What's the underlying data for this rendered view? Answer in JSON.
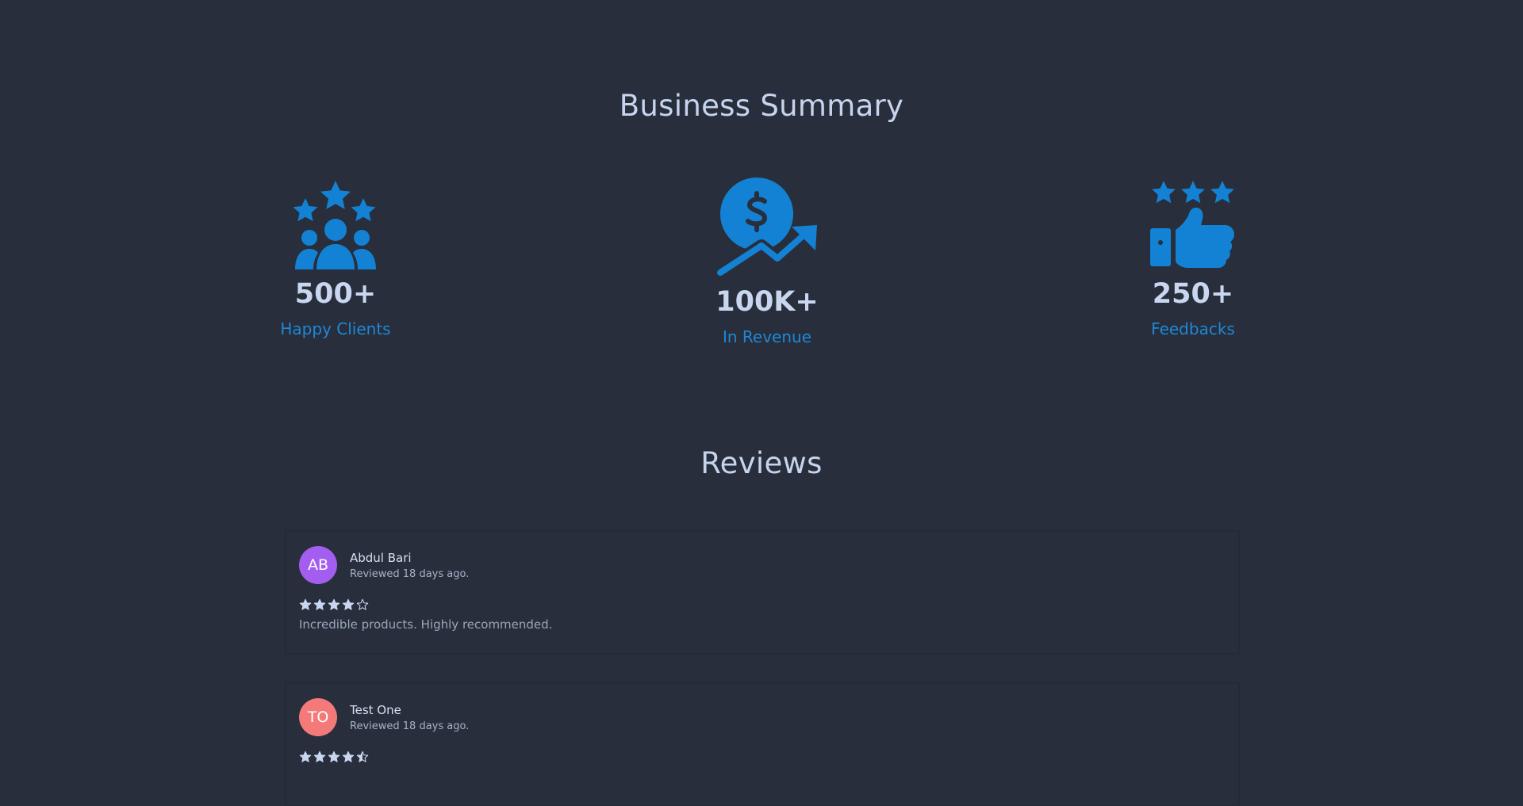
{
  "summary": {
    "title": "Business Summary",
    "stats": [
      {
        "value": "500+",
        "label": "Happy Clients",
        "icon": "clients-stars-icon"
      },
      {
        "value": "100K+",
        "label": "In Revenue",
        "icon": "revenue-growth-icon"
      },
      {
        "value": "250+",
        "label": "Feedbacks",
        "icon": "thumbs-up-stars-icon"
      }
    ]
  },
  "reviews": {
    "title": "Reviews",
    "items": [
      {
        "initials": "AB",
        "avatar_color": "#a35ef0",
        "name": "Abdul Bari",
        "date": "Reviewed 18 days ago.",
        "rating": 4,
        "text": "Incredible products. Highly recommended."
      },
      {
        "initials": "TO",
        "avatar_color": "#f47a7a",
        "name": "Test One",
        "date": "Reviewed 18 days ago.",
        "rating": 4.5,
        "text": ""
      }
    ]
  },
  "colors": {
    "background": "#282e3b",
    "accent": "#1e88d8",
    "text": "#c9d6f0"
  }
}
